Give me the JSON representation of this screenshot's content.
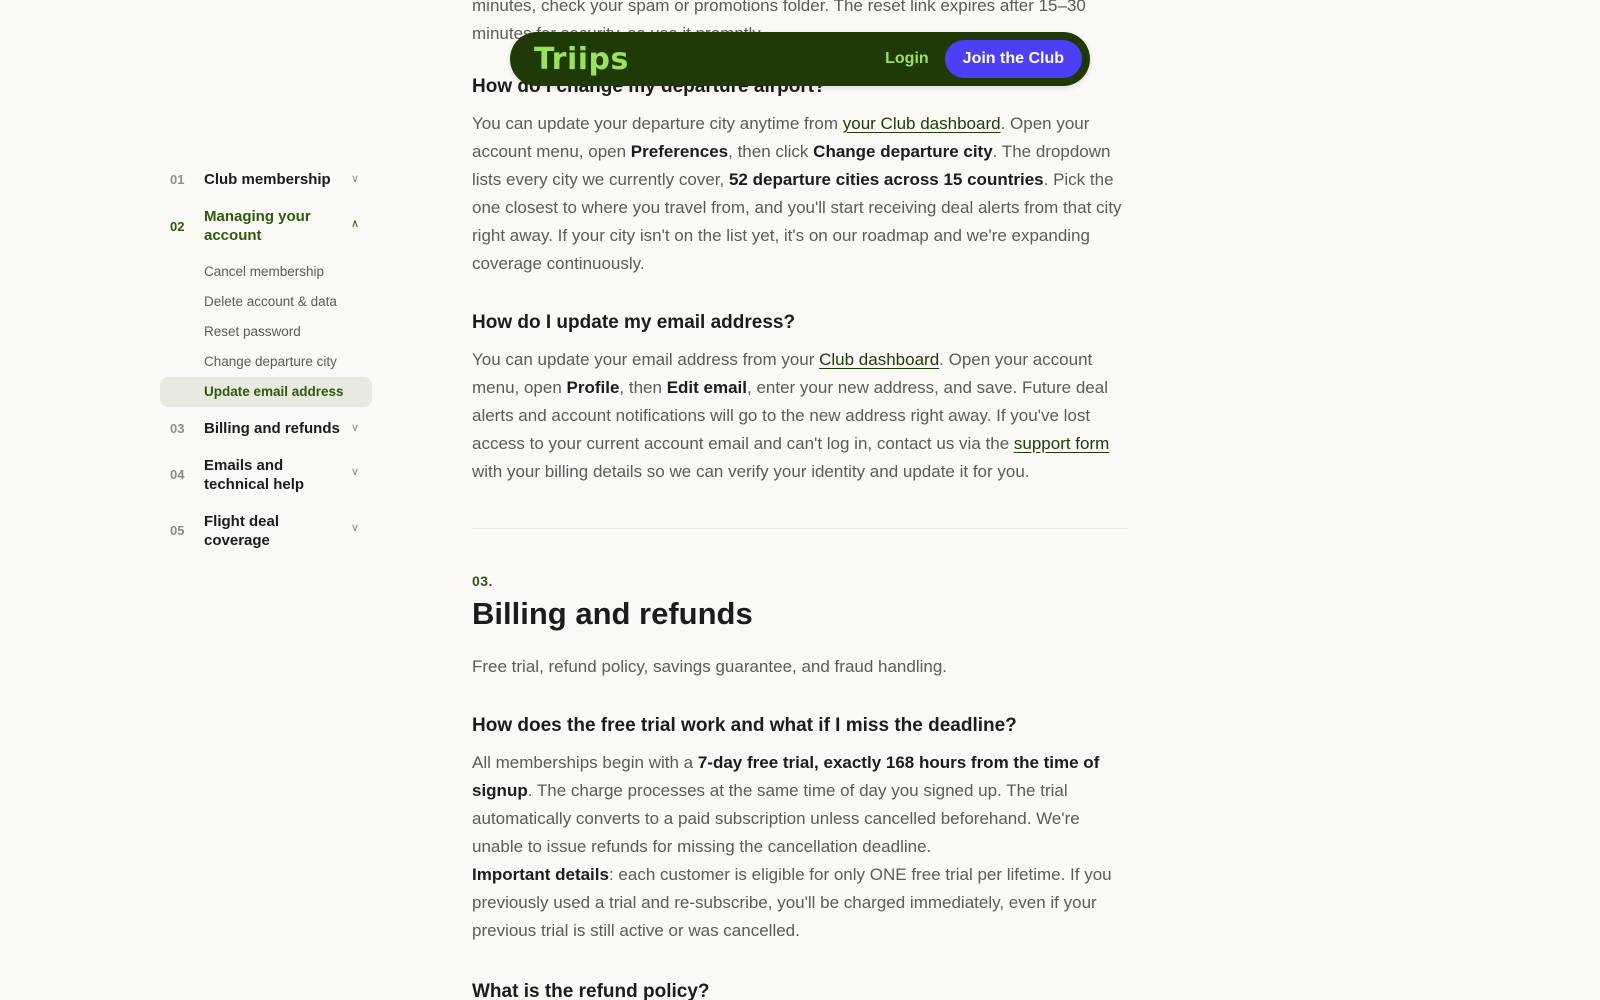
{
  "nav": {
    "logo": "Triips",
    "login": "Login",
    "join": "Join the Club"
  },
  "sidebar": {
    "sections": [
      {
        "num": "01",
        "label": "Club membership"
      },
      {
        "num": "02",
        "label": "Managing your account"
      },
      {
        "num": "03",
        "label": "Billing and refunds"
      },
      {
        "num": "04",
        "label": "Emails and technical help"
      },
      {
        "num": "05",
        "label": "Flight deal coverage"
      }
    ],
    "sub_items": [
      "Cancel membership",
      "Delete account & data",
      "Reset password",
      "Change departure city",
      "Update email address"
    ]
  },
  "content": {
    "top_fragment_1": "minutes, check your spam or promotions folder. The reset link expires after 15–30",
    "top_fragment_2": "minutes for security, so use it promptly.",
    "departure": {
      "question": "How do I change my departure airport?",
      "t1": "You can update your departure city anytime from ",
      "link": "your Club dashboard",
      "t2": ". Open your account menu, open ",
      "b1": "Preferences",
      "t3": ", then click ",
      "b2": "Change departure city",
      "t4": ". The dropdown lists every city we currently cover, ",
      "b3": "52 departure cities across 15 countries",
      "t5": ". Pick the one closest to where you travel from, and you'll start receiving deal alerts from that city right away. If your city isn't on the list yet, it's on our roadmap and we're expanding coverage continuously."
    },
    "email": {
      "question": "How do I update my email address?",
      "t1": "You can update your email address from your ",
      "link1": "Club dashboard",
      "t2": ". Open your account menu, open ",
      "b1": "Profile",
      "t3": ", then ",
      "b2": "Edit email",
      "t4": ", enter your new address, and save. Future deal alerts and account notifications will go to the new address right away. If you've lost access to your current account email and can't log in, contact us via the ",
      "link2": "support form",
      "t5": " with your billing details so we can verify your identity and update it for you."
    },
    "billing": {
      "num": "03.",
      "title": "Billing and refunds",
      "intro": "Free trial, refund policy, savings guarantee, and fraud handling.",
      "trial_q": "How does the free trial work and what if I miss the deadline?",
      "t1": "All memberships begin with a ",
      "b1": "7-day free trial, exactly 168 hours from the time of signup",
      "t2": ". The charge processes at the same time of day you signed up. The trial automatically converts to a paid subscription unless cancelled beforehand. We're unable to issue refunds for missing the cancellation deadline.",
      "b2": "Important details",
      "t3": ": each customer is eligible for only ONE free trial per lifetime. If you previously used a trial and re-subscribe, you'll be charged immediately, even if your previous trial is still active or was cancelled.",
      "refund_q": "What is the refund policy?"
    }
  }
}
